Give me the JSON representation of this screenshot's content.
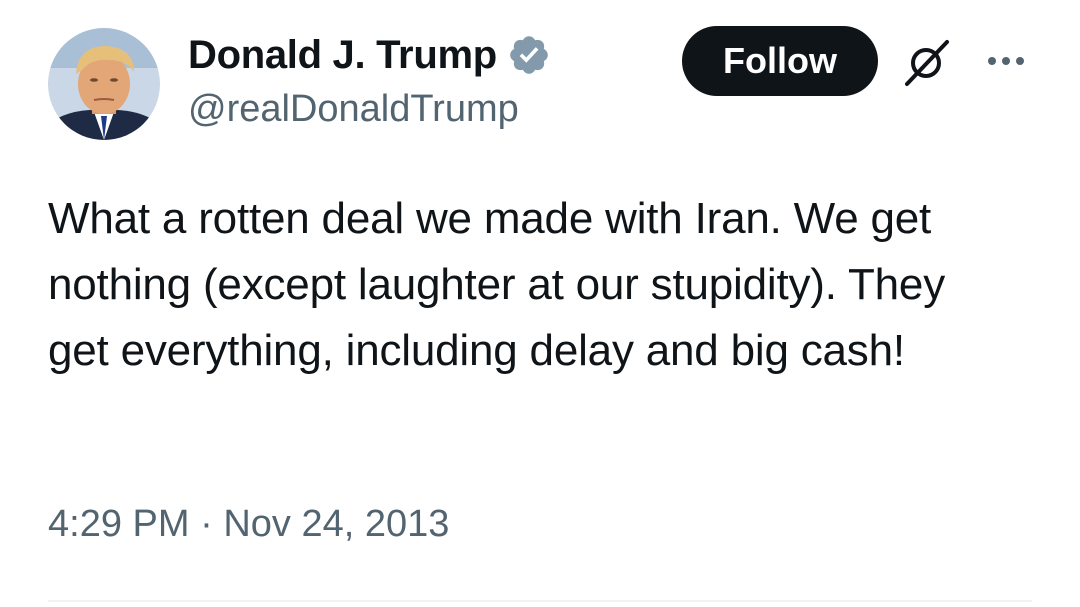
{
  "author": {
    "display_name": "Donald J. Trump",
    "handle": "@realDonaldTrump",
    "verified": true,
    "avatar_icon": "profile-photo"
  },
  "actions": {
    "follow_label": "Follow",
    "grok_icon": "grok-icon",
    "more_icon": "more-options-icon"
  },
  "tweet": {
    "text": "What a rotten deal we made with Iran. We get nothing (except laughter at our stupidity). They get everything, including delay and big cash!",
    "time": "4:29 PM",
    "separator": "·",
    "date": "Nov 24, 2013"
  },
  "colors": {
    "text_primary": "#0f1419",
    "text_secondary": "#536471",
    "verified_badge": "#829aab",
    "follow_bg": "#0f1419"
  }
}
